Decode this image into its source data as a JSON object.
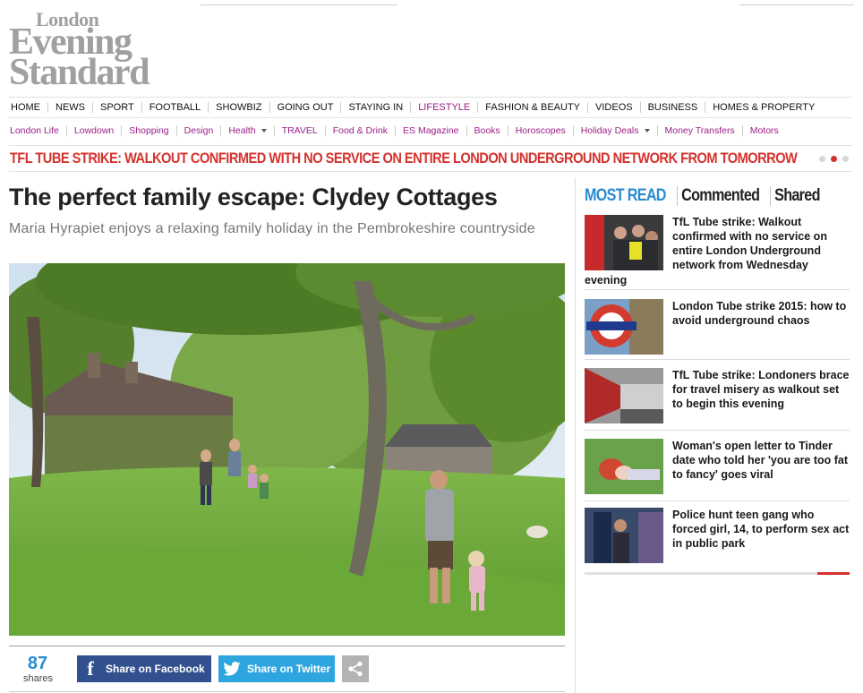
{
  "masthead": {
    "line1": "London",
    "line2": "Evening",
    "line3": "Standard"
  },
  "nav_primary": [
    {
      "label": "HOME",
      "active": false
    },
    {
      "label": "NEWS",
      "active": false
    },
    {
      "label": "SPORT",
      "active": false
    },
    {
      "label": "FOOTBALL",
      "active": false
    },
    {
      "label": "SHOWBIZ",
      "active": false
    },
    {
      "label": "GOING OUT",
      "active": false
    },
    {
      "label": "STAYING IN",
      "active": false
    },
    {
      "label": "LIFESTYLE",
      "active": true
    },
    {
      "label": "FASHION & BEAUTY",
      "active": false
    },
    {
      "label": "VIDEOS",
      "active": false
    },
    {
      "label": "BUSINESS",
      "active": false
    },
    {
      "label": "HOMES & PROPERTY",
      "active": false
    }
  ],
  "nav_secondary": [
    {
      "label": "London Life",
      "dropdown": false
    },
    {
      "label": "Lowdown",
      "dropdown": false
    },
    {
      "label": "Shopping",
      "dropdown": false
    },
    {
      "label": "Design",
      "dropdown": false
    },
    {
      "label": "Health",
      "dropdown": true
    },
    {
      "label": "TRAVEL",
      "dropdown": false
    },
    {
      "label": "Food & Drink",
      "dropdown": false
    },
    {
      "label": "ES Magazine",
      "dropdown": false
    },
    {
      "label": "Books",
      "dropdown": false
    },
    {
      "label": "Horoscopes",
      "dropdown": false
    },
    {
      "label": "Holiday Deals",
      "dropdown": true
    },
    {
      "label": "Money Transfers",
      "dropdown": false
    },
    {
      "label": "Motors",
      "dropdown": false
    }
  ],
  "ticker": {
    "text": "TFL TUBE STRIKE: WALKOUT CONFIRMED WITH NO SERVICE ON ENTIRE LONDON UNDERGROUND NETWORK FROM TOMORROW",
    "slides": 3,
    "active_slide": 2
  },
  "article": {
    "headline": "The perfect family escape: Clydey Cottages",
    "standfirst": "Maria Hyrapiet enjoys a relaxing family holiday in the Pembrokeshire countryside"
  },
  "share": {
    "count": "87",
    "count_label": "shares",
    "facebook_label": "Share on Facebook",
    "twitter_label": "Share on Twitter"
  },
  "sidebar": {
    "tabs": [
      {
        "label": "MOST READ",
        "active": true
      },
      {
        "label": "Commented",
        "active": false
      },
      {
        "label": "Shared",
        "active": false
      }
    ],
    "stories": [
      {
        "title": "TfL Tube strike: Walkout confirmed with no service on entire London Underground network from Wednesday",
        "tail": "evening"
      },
      {
        "title": "London Tube strike 2015: how to avoid underground chaos",
        "tail": ""
      },
      {
        "title": "TfL Tube strike: Londoners brace for travel misery as walkout set to begin this evening",
        "tail": ""
      },
      {
        "title": "Woman's open letter to Tinder date who told her 'you are too fat to fancy' goes viral",
        "tail": ""
      },
      {
        "title": "Police hunt teen gang who forced girl, 14, to perform sex act in public park",
        "tail": ""
      }
    ]
  },
  "colors": {
    "brand_purple": "#9b1e86",
    "breaking_red": "#d4322d",
    "accent_blue": "#2a8bd0",
    "facebook": "#33508e",
    "twitter": "#2fa5e0",
    "logo_grey": "#a0a0a0"
  },
  "icons": [
    "facebook-icon",
    "twitter-icon",
    "share-icon",
    "caret-down-icon"
  ]
}
